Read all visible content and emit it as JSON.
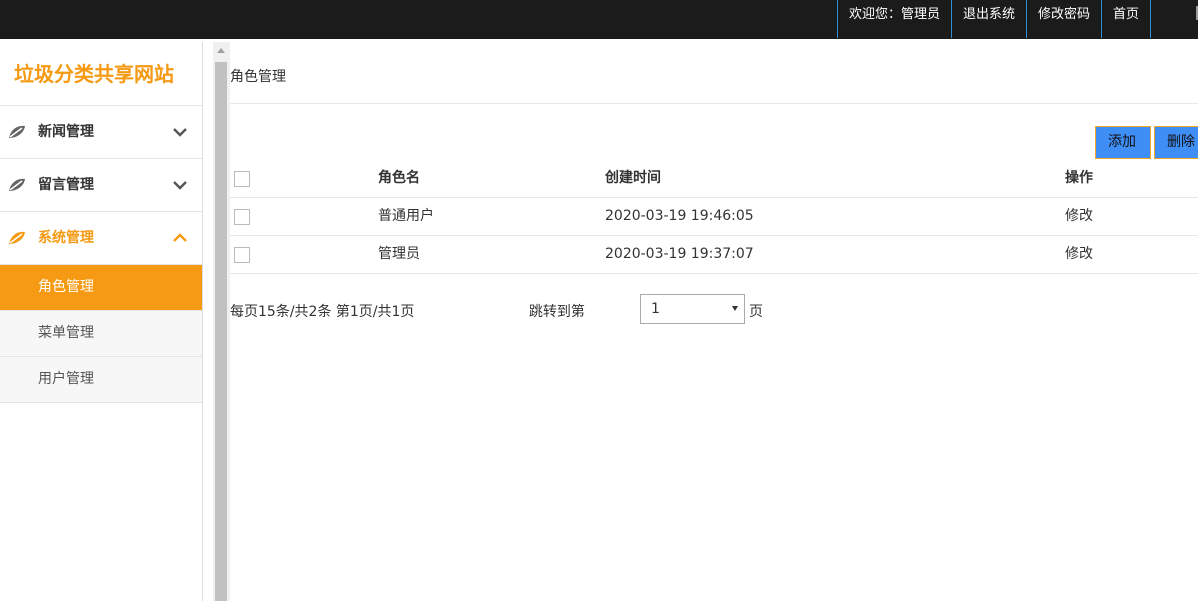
{
  "header": {
    "nav": [
      {
        "label": "欢迎您：管理员"
      },
      {
        "label": "退出系统"
      },
      {
        "label": "修改密码"
      },
      {
        "label": "首页"
      }
    ]
  },
  "sidebar": {
    "site_title": "垃圾分类共享网站",
    "groups": [
      {
        "label": "新闻管理",
        "icon": "leaf-icon",
        "state": "collapsed"
      },
      {
        "label": "留言管理",
        "icon": "leaf-icon",
        "state": "collapsed"
      },
      {
        "label": "系统管理",
        "icon": "leaf-icon",
        "state": "expanded"
      }
    ],
    "sub_items": [
      {
        "label": "角色管理",
        "active": true
      },
      {
        "label": "菜单管理",
        "active": false
      },
      {
        "label": "用户管理",
        "active": false
      }
    ]
  },
  "main": {
    "breadcrumb": "角色管理",
    "buttons": {
      "add": "添加",
      "delete": "删除"
    },
    "table": {
      "headers": {
        "name": "角色名",
        "time": "创建时间",
        "op": "操作"
      },
      "rows": [
        {
          "name": "普通用户",
          "time": "2020-03-19 19:46:05",
          "op": "修改"
        },
        {
          "name": "管理员",
          "time": "2020-03-19 19:37:07",
          "op": "修改"
        }
      ]
    },
    "pager": {
      "info": "每页15条/共2条 第1页/共1页",
      "jump_label": "跳转到第",
      "page_value": "1",
      "suffix": "页"
    }
  },
  "colors": {
    "accent": "#f59a12",
    "button": "#3f8ef6",
    "topbar": "#1b1b1b"
  }
}
